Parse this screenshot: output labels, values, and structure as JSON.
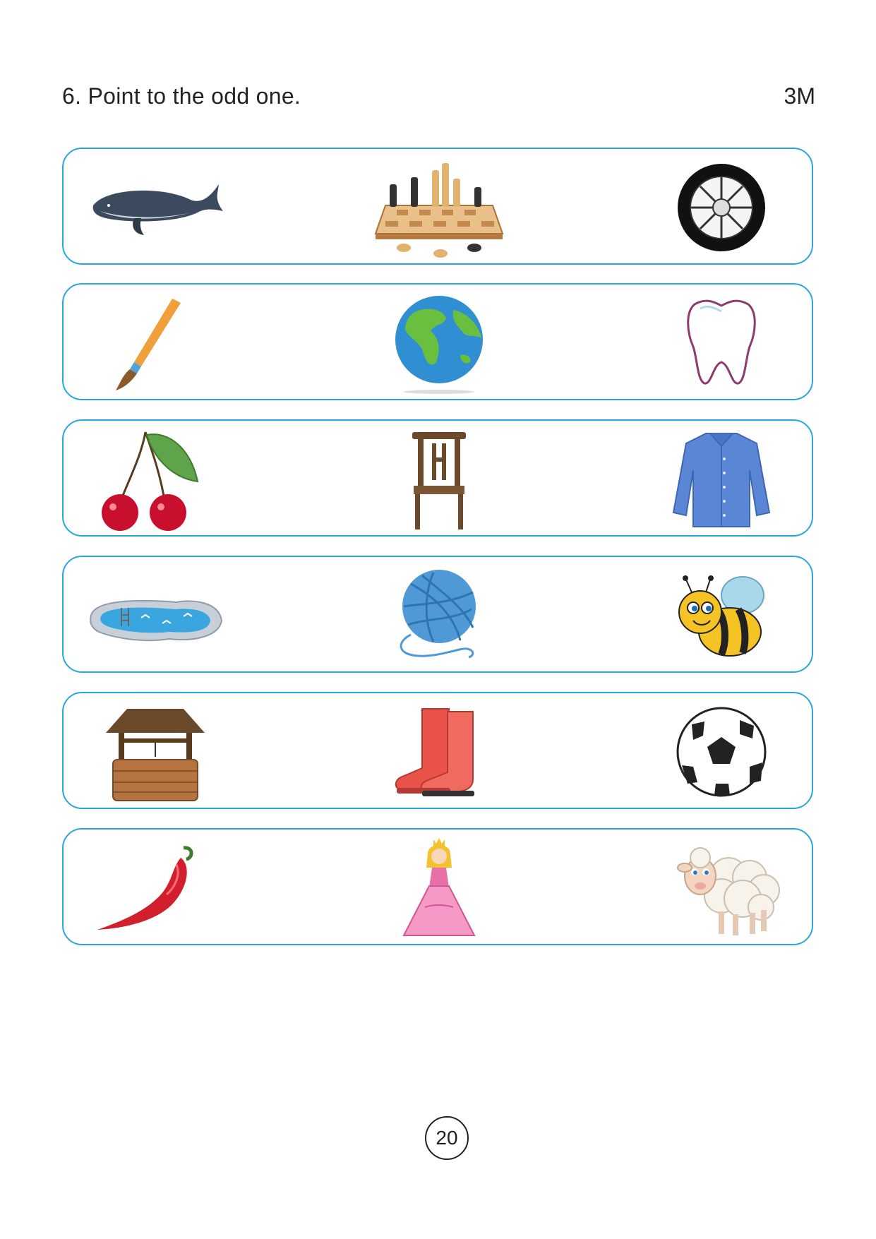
{
  "question": {
    "text": "6. Point to the odd one.",
    "marks": "3M"
  },
  "rows": [
    {
      "items": [
        "whale-icon",
        "chess-board-icon",
        "tyre-icon"
      ]
    },
    {
      "items": [
        "paintbrush-icon",
        "globe-icon",
        "tooth-icon"
      ]
    },
    {
      "items": [
        "cherries-icon",
        "chair-icon",
        "shirt-icon"
      ]
    },
    {
      "items": [
        "swimming-pool-icon",
        "yarn-ball-icon",
        "bee-icon"
      ]
    },
    {
      "items": [
        "wishing-well-icon",
        "boots-icon",
        "football-icon"
      ]
    },
    {
      "items": [
        "chilli-icon",
        "princess-icon",
        "sheep-icon"
      ]
    }
  ],
  "page_number": "20",
  "colors": {
    "border": "#28a7df",
    "text": "#222222"
  }
}
